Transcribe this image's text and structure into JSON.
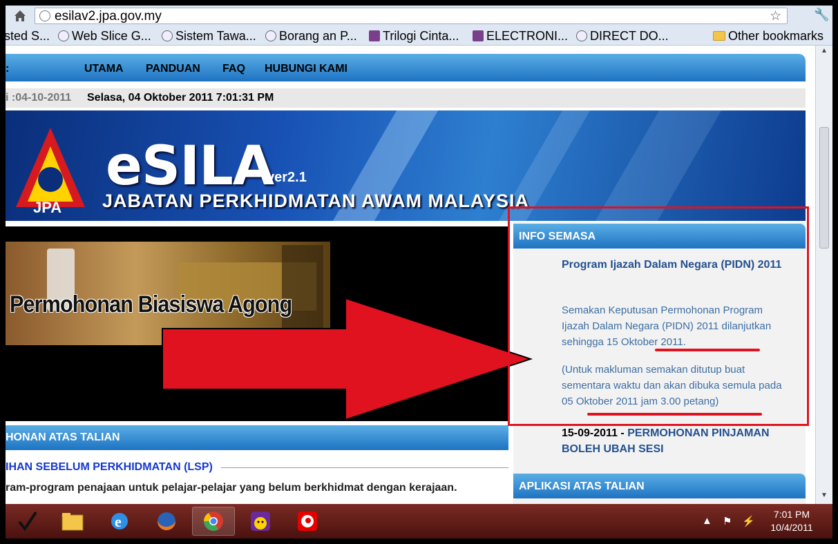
{
  "browser": {
    "url": "esilav2.jpa.gov.my",
    "bookmarks": [
      "sted S...",
      "Web Slice G...",
      "Sistem Tawa...",
      "Borang an P...",
      "Trilogi Cinta...",
      "ELECTRONI...",
      "DIRECT DO...",
      "Other bookmarks"
    ]
  },
  "nav": {
    "stub": ":",
    "items": [
      "UTAMA",
      "PANDUAN",
      "FAQ",
      "HUBUNGI KAMI"
    ]
  },
  "datebar": {
    "left": "i :04-10-2011",
    "right": "Selasa, 04 Oktober 2011 7:01:31 PM"
  },
  "banner": {
    "title": "eSILA",
    "version": "ver2.1",
    "subtitle": "JABATAN PERKHIDMATAN AWAM MALAYSIA",
    "logo_text": "JPA"
  },
  "biasiswa": {
    "text": "Permohonan Biasiswa Agong"
  },
  "left_panel": {
    "header": "HONAN ATAS TALIAN",
    "lsp_title": "IHAN SEBELUM PERKHIDMATAN (LSP)",
    "lsp_desc": "ram-program penajaan untuk pelajar-pelajar yang belum berkhidmat dengan kerajaan."
  },
  "info": {
    "header": "INFO SEMASA",
    "title": "Program Ijazah Dalam Negara (PIDN) 2011",
    "para1": "Semakan Keputusan Permohonan Program Ijazah Dalam Negara (PIDN) 2011 dilanjutkan sehingga 15 Oktober 2011.",
    "para2": "(Untuk makluman semakan ditutup buat sementara waktu dan akan dibuka semula pada 05 Oktober 2011 jam 3.00 petang)",
    "news2_date": "15-09-2011 -",
    "news2_link": "PERMOHONAN PINJAMAN BOLEH UBAH SESI"
  },
  "aplikasi": {
    "header": "APLIKASI ATAS TALIAN"
  },
  "taskbar": {
    "time": "7:01 PM",
    "date": "10/4/2011"
  },
  "colors": {
    "nav_blue": "#1e73c2",
    "highlight_red": "#e0121f",
    "info_text": "#3d6ea3",
    "info_title": "#23508f"
  }
}
